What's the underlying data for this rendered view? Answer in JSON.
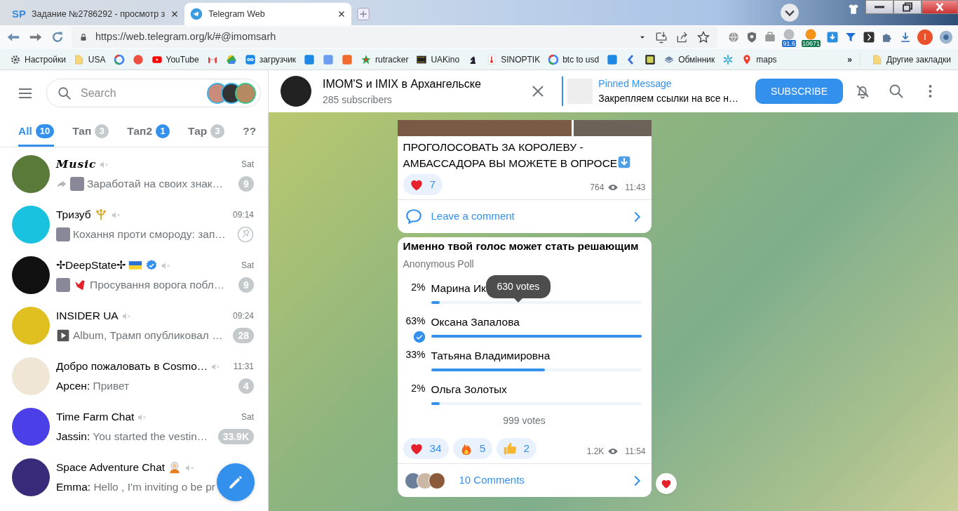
{
  "browser": {
    "tabs": [
      {
        "title": "Задание №2786292 - просмотр з",
        "selected": false,
        "favicon_text": "SP"
      },
      {
        "title": "Telegram Web",
        "selected": true
      }
    ],
    "url": "https://web.telegram.org/k/#@imomsarh",
    "extension_badges": [
      {
        "text": "91.6",
        "color": "#1e6fd0"
      },
      {
        "text": "10671",
        "color": "#0f7a4f"
      }
    ],
    "profile_initial": "I",
    "bookmarks": [
      "Настройки",
      "USA",
      "YouTube",
      "загрузчик",
      "rutracker",
      "UAKino",
      "SINOPTIK",
      "btc to usd",
      "Обмінник",
      "maps"
    ],
    "bookmarks_more": "»",
    "other_bookmarks": "Другие закладки"
  },
  "sidebar": {
    "search": {
      "placeholder": "Search"
    },
    "folders": [
      {
        "label": "All",
        "count": "10",
        "selected": true,
        "muted": false
      },
      {
        "label": "Тап",
        "count": "3",
        "selected": false,
        "muted": true
      },
      {
        "label": "Тап2",
        "count": "1",
        "selected": false,
        "muted": false
      },
      {
        "label": "Тар",
        "count": "3",
        "selected": false,
        "muted": true
      },
      {
        "label": "??",
        "selected": false
      }
    ],
    "chats": [
      {
        "name": "Music",
        "muted": true,
        "verified": false,
        "forwarded": true,
        "time": "Sat",
        "preview": "Заработай на своих знак…",
        "unread": "9"
      },
      {
        "name": "Тризуб",
        "muted": true,
        "verified": false,
        "forwarded": false,
        "time": "09:14",
        "preview": "Кохання проти смороду: зап…",
        "pinned": true
      },
      {
        "name": "✢DeepState✢",
        "verified": true,
        "muted": true,
        "forwarded": false,
        "time": "Sat",
        "preview": "Просування ворога побл…",
        "unread": "9"
      },
      {
        "name": "INSIDER UA",
        "muted": true,
        "verified": false,
        "forwarded": false,
        "time": "09:24",
        "preview": "Album, Трамп опубликовал …",
        "unread": "28"
      },
      {
        "name": "Добро пожаловать в Cosmo…",
        "muted": true,
        "verified": false,
        "forwarded": false,
        "time": "11:31",
        "sender": "Арсен:",
        "preview": "Привет",
        "unread": "4"
      },
      {
        "name": "Time Farm Chat",
        "muted": true,
        "verified": false,
        "forwarded": false,
        "time": "Sat",
        "sender": "Jassin:",
        "preview": "You started the vestin…",
        "unread": "33.9K"
      },
      {
        "name": "Space Adventure Chat",
        "muted": true,
        "verified": false,
        "forwarded": false,
        "sender": "Emma:",
        "preview": "Hello , I'm inviting o be pr"
      }
    ]
  },
  "chat": {
    "title": "IMOM'S и IMIX в Архангельске",
    "subtitle": "285 subscribers",
    "pinned": {
      "label": "Pinned Message",
      "text": "Закрепляем ссылки на все н…"
    },
    "subscribe": "SUBSCRIBE",
    "messages": [
      {
        "kind": "post",
        "text": "ПРОГОЛОСОВАТЬ ЗА КОРОЛЕВУ - АМБАССАДОРА ВЫ МОЖЕТЕ В ОПРОСЕ",
        "reactions": [
          {
            "kind": "heart",
            "count": "7"
          }
        ],
        "views": "764",
        "time": "11:43",
        "comments": {
          "kind": "leave",
          "label": "Leave a comment"
        }
      },
      {
        "kind": "poll",
        "question": "Именно твой голос может стать решающим",
        "poll_type": "Anonymous Poll",
        "options": [
          {
            "percent": "2%",
            "text": "Марина Ик",
            "level": 0.04,
            "chosen": false
          },
          {
            "percent": "63%",
            "text": "Оксана Запалова",
            "level": 1,
            "chosen": true
          },
          {
            "percent": "33%",
            "text": "Татьяна Владимировна",
            "level": 0.54,
            "chosen": false
          },
          {
            "percent": "2%",
            "text": "Ольга Золотых",
            "level": 0.04,
            "chosen": false
          }
        ],
        "tooltip": "630 votes",
        "total": "999 votes",
        "reactions": [
          {
            "kind": "heart",
            "count": "34"
          },
          {
            "kind": "fire",
            "count": "5"
          },
          {
            "kind": "thumbs-up",
            "count": "2"
          }
        ],
        "views": "1.2K",
        "time": "11:54",
        "comments": {
          "kind": "count",
          "label": "10 Comments"
        }
      }
    ]
  }
}
